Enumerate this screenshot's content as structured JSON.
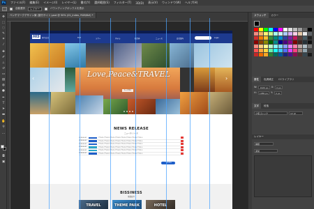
{
  "menubar": {
    "items": [
      "ファイル(F)",
      "編集(E)",
      "イメージ(I)",
      "レイヤー(L)",
      "書式(Y)",
      "選択範囲(S)",
      "フィルター(T)",
      "3D(D)",
      "表示(V)",
      "ウィンドウ(W)",
      "ヘルプ(H)"
    ]
  },
  "optbar": {
    "auto_select_label": "自動選択",
    "layer_select": "レイヤー",
    "transform_label": "バウンディングボックスを表示"
  },
  "tab": {
    "title": "ベンチマークデザイン案 (旅行サイト).psd @ 50% (01_index, RGB/8#) *"
  },
  "site": {
    "topbar_text": "HIS online",
    "logo": "HIS",
    "logo_sub": "旅行会社",
    "nav": [
      "TOP",
      "ツアー",
      "ホテル",
      "航空券",
      "ニュース",
      "会社案内"
    ],
    "nav_right": "Login",
    "hero_title": "Love,Peace&TRAVEL",
    "hero_button": "もっと見る",
    "news_title": "NEWS RELEASE",
    "news_sub": "ニュースリリース",
    "news": [
      {
        "date": "2018.06.01",
        "category_color": "#1d5ec9",
        "text": "テキストテキストテキストテキストテキストテキストテキストテキスト"
      },
      {
        "date": "2018.06.01",
        "category_color": "#1d5ec9",
        "text": "テキストテキストテキストテキストテキストテキストテキストテキスト"
      },
      {
        "date": "2018.06.01",
        "category_color": "#1d5ec9",
        "text": "テキストテキストテキストテキストテキストテキストテキストテキスト"
      },
      {
        "date": "2018.06.01",
        "category_color": "#2aa6c9",
        "text": "テキストテキストテキストテキストテキストテキストテキストテキスト"
      },
      {
        "date": "2018.06.01",
        "category_color": "#2aa6c9",
        "text": "テキストテキストテキストテキストテキストテキストテキストテキスト"
      },
      {
        "date": "2018.06.01",
        "category_color": "#1d5ec9",
        "text": "テキストテキストテキストテキストテキストテキストテキストテキスト"
      }
    ],
    "news_more": "一覧を見る",
    "business_title": "BISSINESS",
    "business_sub": "事業紹介",
    "business_cards": [
      "TRAVEL",
      "THEME PARK",
      "HOTEL"
    ]
  },
  "panels": {
    "top_tabs": [
      "スウォッチ",
      "カラー"
    ],
    "properties_tabs": [
      "属性",
      "色調補正",
      "CCライブラリ"
    ],
    "prop_rows": [
      {
        "label": "W:",
        "value": "1920 px"
      },
      {
        "label": "X:",
        "value": "0 px"
      },
      {
        "label": "H:",
        "value": "1080 px"
      },
      {
        "label": "Y:",
        "value": "0 px"
      }
    ],
    "char_tabs": [
      "文字",
      "段落"
    ],
    "char_font": "小塚ゴシック",
    "char_size": "12 pt",
    "layers_header": "レイヤー",
    "layers_kind": "種類",
    "layers_mode": "通常"
  },
  "colors": {
    "accent": "#1d3a8f",
    "guide": "#4aa3ff",
    "ps_bg": "#535353"
  }
}
